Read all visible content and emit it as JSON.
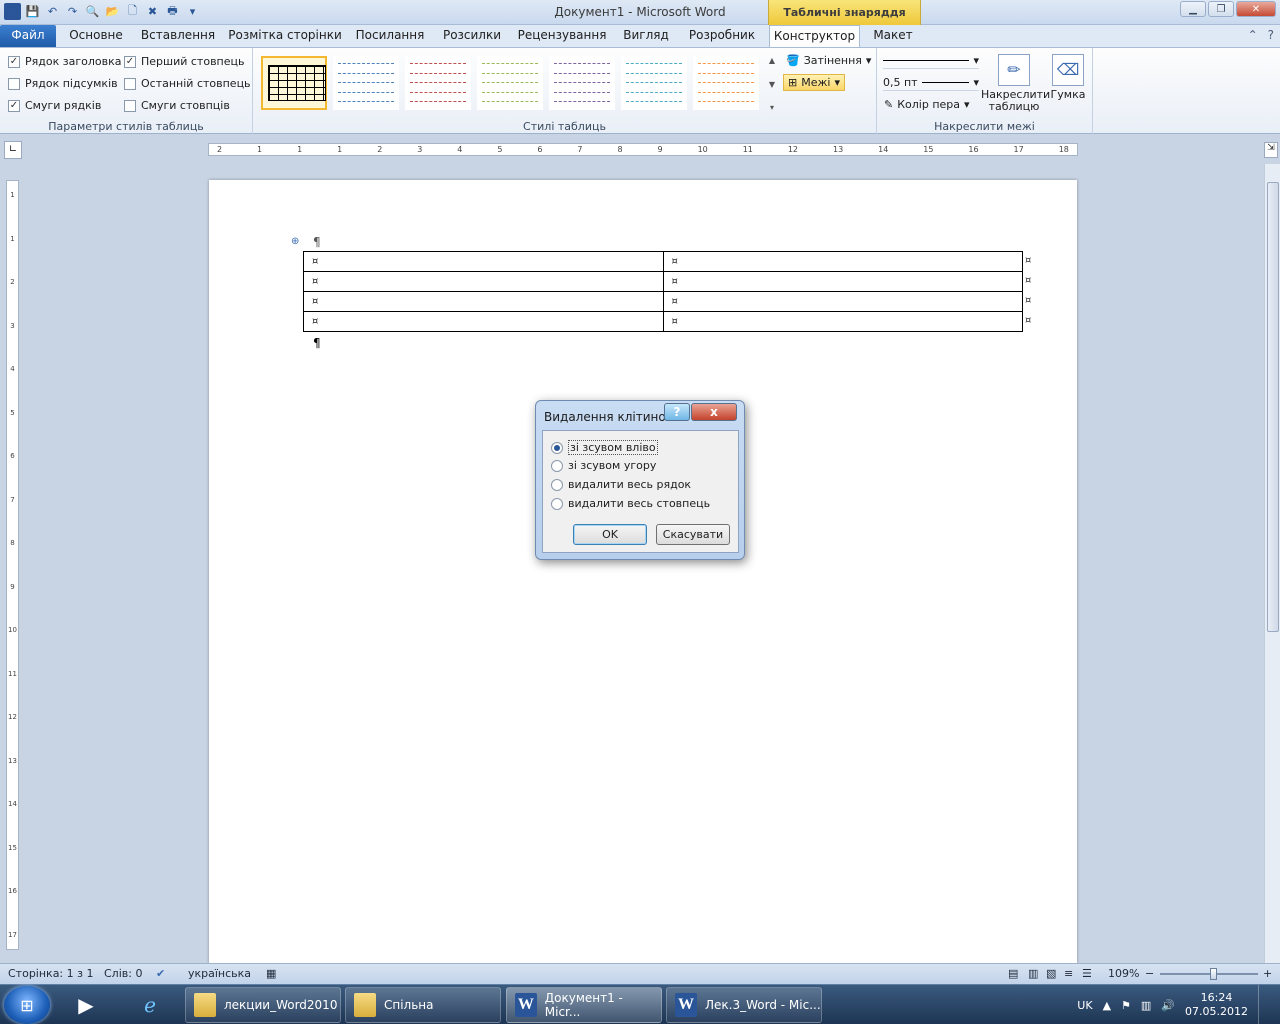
{
  "window": {
    "title": "Документ1  -  Microsoft Word",
    "context_tab_header": "Табличні знаряддя"
  },
  "tabs": [
    {
      "label": "Файл"
    },
    {
      "label": "Основне"
    },
    {
      "label": "Вставлення"
    },
    {
      "label": "Розмітка сторінки"
    },
    {
      "label": "Посилання"
    },
    {
      "label": "Розсилки"
    },
    {
      "label": "Рецензування"
    },
    {
      "label": "Вигляд"
    },
    {
      "label": "Розробник"
    },
    {
      "label": "Конструктор"
    },
    {
      "label": "Макет"
    }
  ],
  "ribbon": {
    "table_style_options": {
      "label": "Параметри стилів таблиць",
      "options": [
        {
          "label": "Рядок заголовка",
          "checked": true
        },
        {
          "label": "Перший стовпець",
          "checked": true
        },
        {
          "label": "Рядок підсумків",
          "checked": false
        },
        {
          "label": "Останній стовпець",
          "checked": false
        },
        {
          "label": "Смуги рядків",
          "checked": true
        },
        {
          "label": "Смуги стовпців",
          "checked": false
        }
      ]
    },
    "table_styles": {
      "label": "Стилі таблиць",
      "swatch_colors": [
        "#000000",
        "#4f81bd",
        "#c0504d",
        "#9bbb59",
        "#8064a2",
        "#4bacc6",
        "#f79646"
      ]
    },
    "draw_borders": {
      "label": "Накреслити межі",
      "shading": "Затінення",
      "borders": "Межі",
      "line_weight": "0,5 пт",
      "pen_color": "Колір пера",
      "draw_table": "Накреслити таблицю",
      "eraser": "Гумка"
    }
  },
  "ruler": {
    "horizontal": [
      "2",
      "1",
      "1",
      "1",
      "2",
      "3",
      "4",
      "5",
      "6",
      "7",
      "8",
      "9",
      "10",
      "11",
      "12",
      "13",
      "14",
      "15",
      "16",
      "17",
      "18"
    ],
    "vertical": [
      "1",
      "1",
      "2",
      "3",
      "4",
      "5",
      "6",
      "7",
      "8",
      "9",
      "10",
      "11",
      "12",
      "13",
      "14",
      "15",
      "16",
      "17"
    ]
  },
  "document": {
    "pilcrow": "¶",
    "cell_marker": "¤",
    "table": {
      "rows": 4,
      "cols": 2
    }
  },
  "dialog": {
    "title": "Видалення клітинок",
    "help": "?",
    "close": "x",
    "options": [
      {
        "label": "зі зсувом вліво",
        "selected": true
      },
      {
        "label": "зі зсувом угору",
        "selected": false
      },
      {
        "label": "видалити весь рядок",
        "selected": false
      },
      {
        "label": "видалити весь стовпець",
        "selected": false
      }
    ],
    "ok": "OK",
    "cancel": "Скасувати"
  },
  "statusbar": {
    "page": "Сторінка: 1 з 1",
    "words": "Слів: 0",
    "language": "українська",
    "zoom": "109%",
    "zoom_minus": "−",
    "zoom_plus": "+",
    "zoom_level_fraction": 0.55
  },
  "taskbar": {
    "tasks": [
      {
        "label": "лекции_Word2010",
        "icon": "folder-icon"
      },
      {
        "label": "Спільна",
        "icon": "folder-icon"
      },
      {
        "label": "Документ1 - Micr...",
        "icon": "word-icon"
      },
      {
        "label": "Лек.3_Word - Mic...",
        "icon": "word-icon"
      }
    ],
    "lang": "UK",
    "time": "16:24",
    "date": "07.05.2012"
  }
}
